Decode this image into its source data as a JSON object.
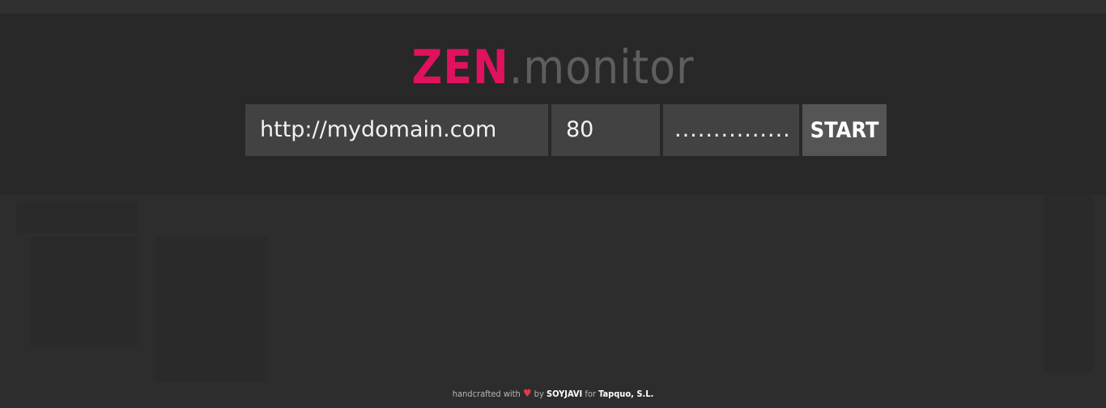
{
  "app": {
    "brand": "ZEN",
    "separator": ".",
    "product": "monitor"
  },
  "form": {
    "url_value": "http://mydomain.com",
    "port_value": "80",
    "secret_mask": "...............",
    "start_label": "START"
  },
  "footer": {
    "prefix": "handcrafted with",
    "heart": "♥",
    "by_text": "by",
    "author": "SOYJAVI",
    "for_text": "for",
    "company": "Tapquo, S.L."
  },
  "colors": {
    "accent": "#e0115f",
    "logo_muted": "#5e5e5e",
    "input_bg": "#424242",
    "button_bg": "#555555",
    "header_bg": "#282828",
    "page_bg": "#2d2d2d"
  },
  "icons": {
    "heart": "heart-icon"
  }
}
